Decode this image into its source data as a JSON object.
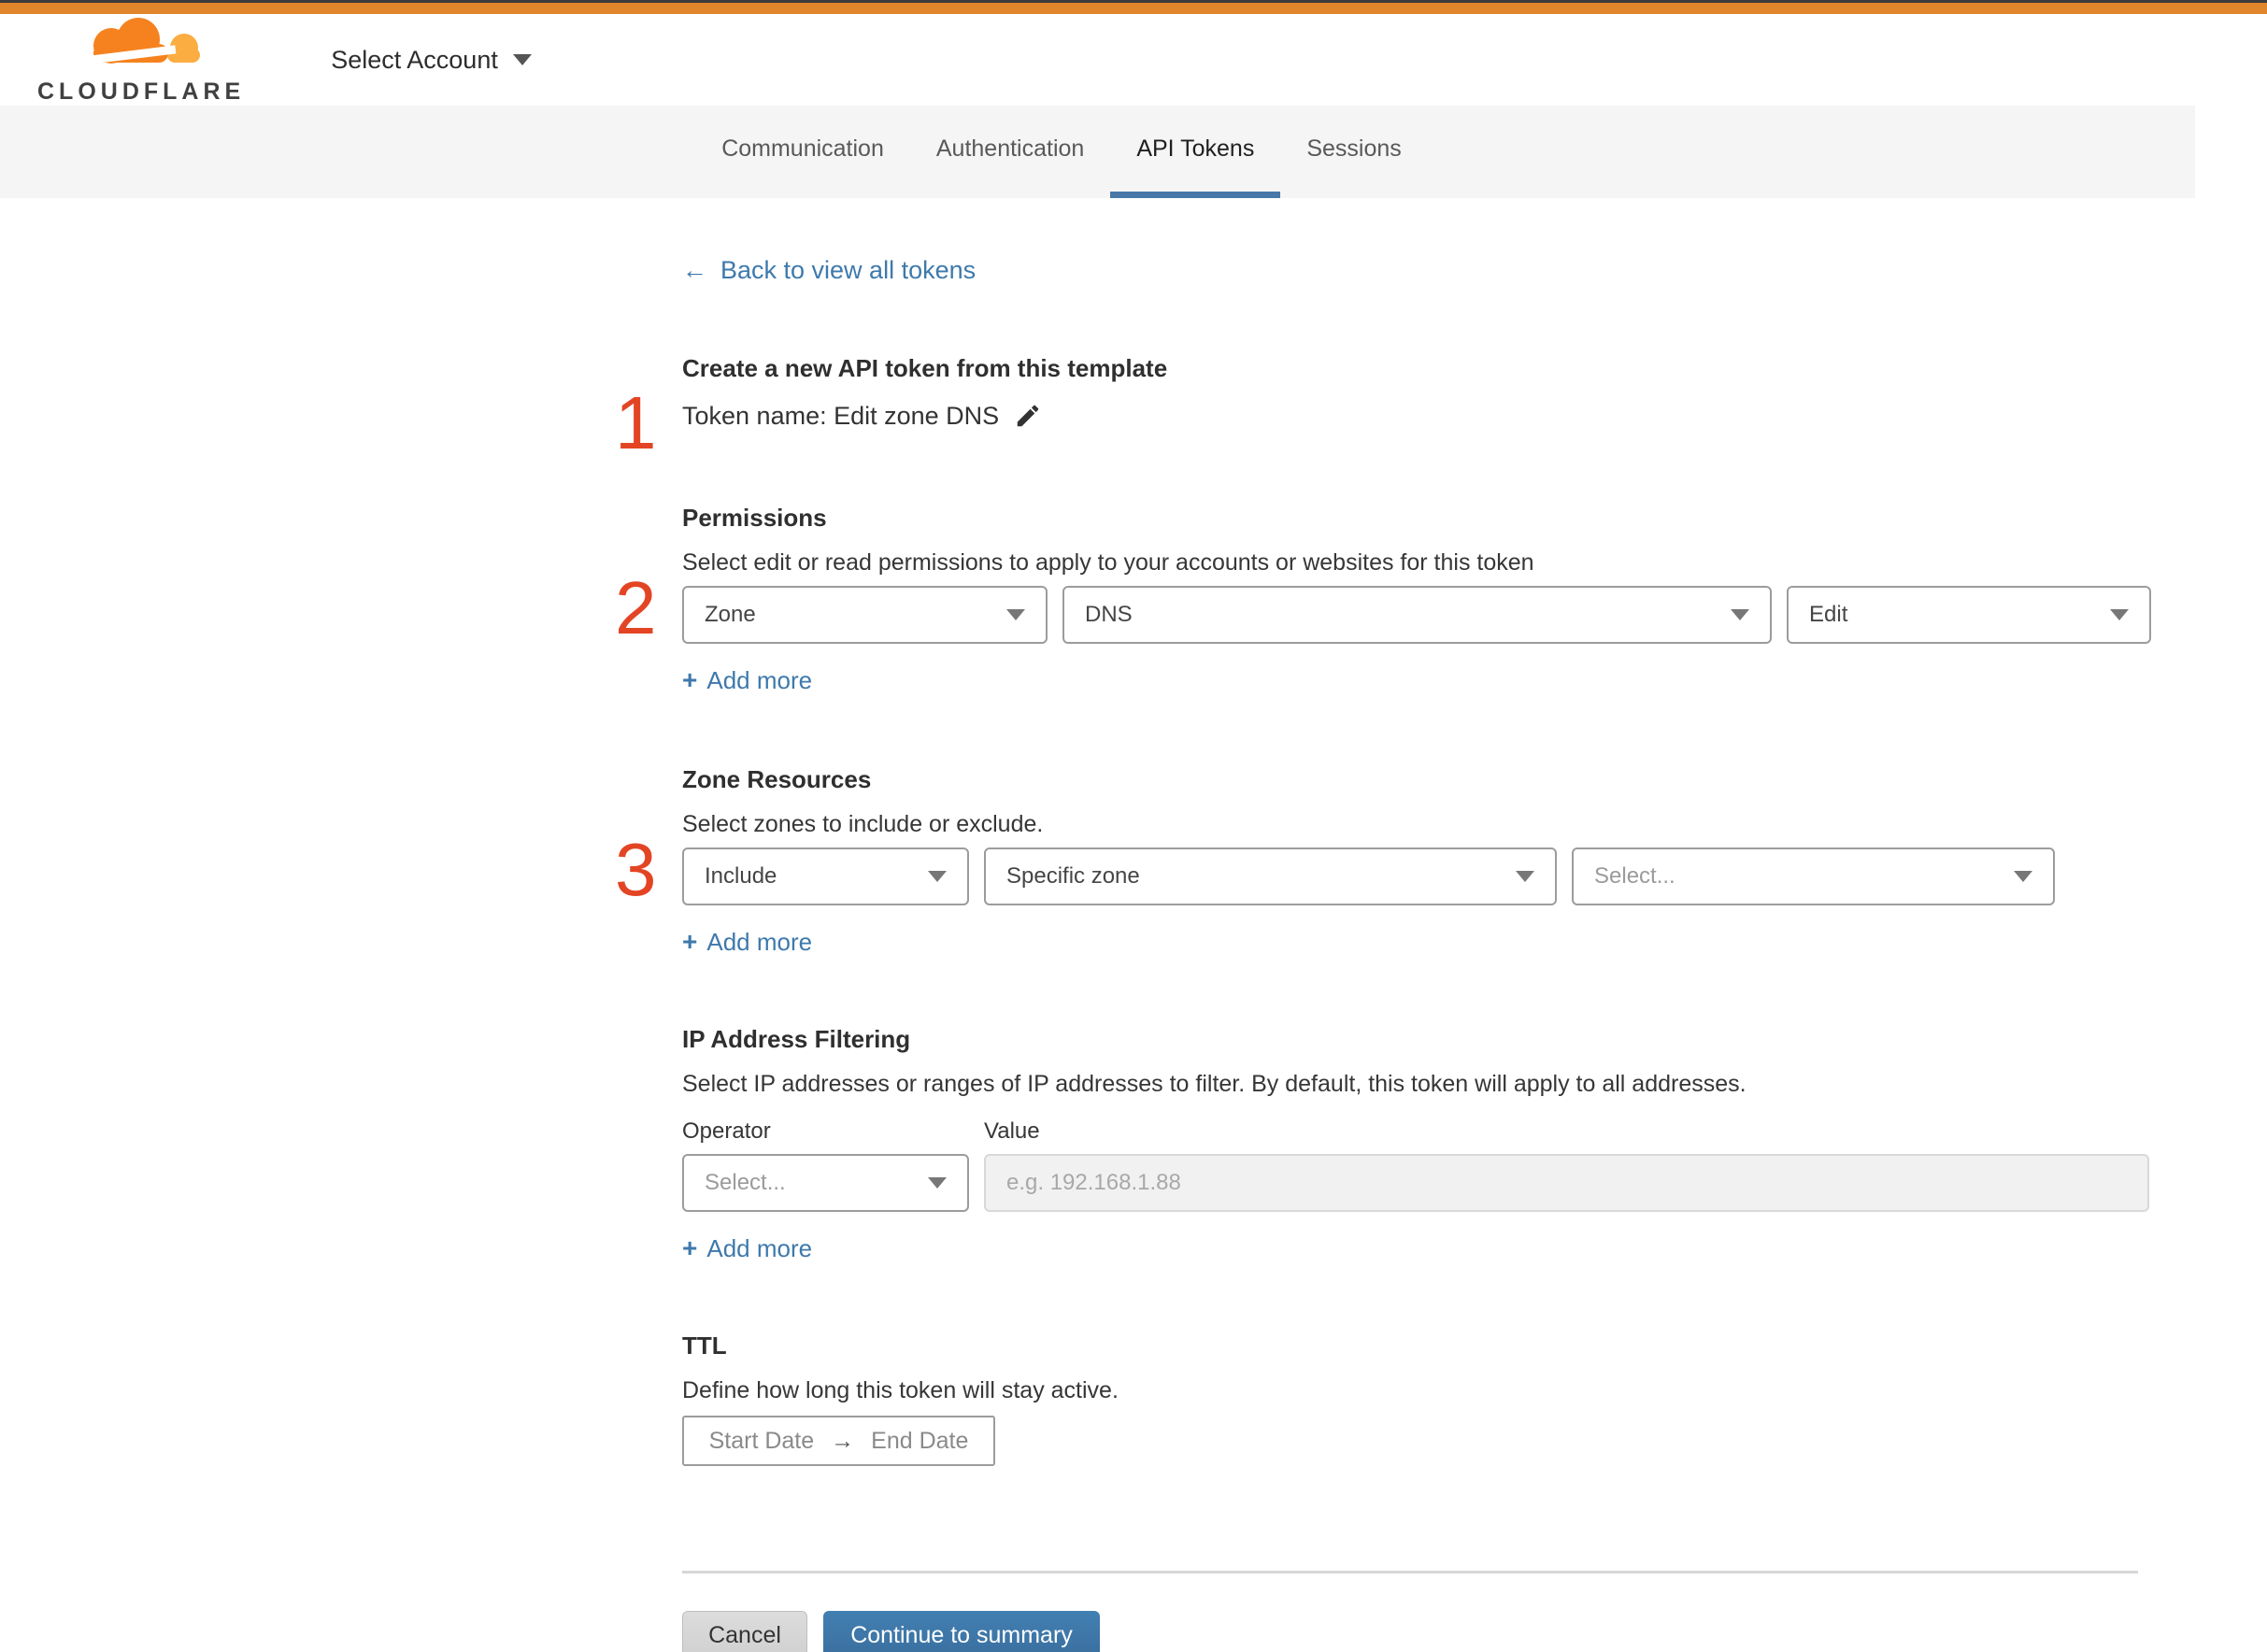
{
  "colors": {
    "top_bar_orange": "#e0862b",
    "brand_orange": "#f6821f",
    "brand_orange_light": "#fbad41",
    "link_blue": "#3e79ac",
    "tab_underline_blue": "#4778a8",
    "step_number_red": "#e34524",
    "primary_button_blue": "#3e74a5"
  },
  "header": {
    "logo_text": "CLOUDFLARE",
    "account_selector_label": "Select Account"
  },
  "tabs": {
    "active": "API Tokens",
    "items": [
      {
        "label": "Communication"
      },
      {
        "label": "Authentication"
      },
      {
        "label": "API Tokens"
      },
      {
        "label": "Sessions"
      }
    ]
  },
  "back_link": {
    "icon": "←",
    "label": "Back to view all tokens"
  },
  "icons": {
    "plus": "+",
    "back_arrow": "←",
    "range_arrow": "→",
    "pencil": "edit-pencil",
    "caret": "dropdown-caret"
  },
  "token_form": {
    "step1": {
      "number": "1",
      "heading": "Create a new API token from this template",
      "token_name": "Token name: Edit zone DNS"
    },
    "permissions": {
      "number": "2",
      "heading": "Permissions",
      "description": "Select edit or read permissions to apply to your accounts or websites for this token",
      "scope_value": "Zone",
      "resource_value": "DNS",
      "access_value": "Edit",
      "add_more_label": "Add more"
    },
    "zone_resources": {
      "number": "3",
      "heading": "Zone Resources",
      "description": "Select zones to include or exclude.",
      "operator_value": "Include",
      "type_value": "Specific zone",
      "zone_placeholder": "Select...",
      "add_more_label": "Add more"
    },
    "ip_filtering": {
      "heading": "IP Address Filtering",
      "description": "Select IP addresses or ranges of IP addresses to filter. By default, this token will apply to all addresses.",
      "operator_label": "Operator",
      "value_label": "Value",
      "operator_placeholder": "Select...",
      "value_placeholder": "e.g. 192.168.1.88",
      "add_more_label": "Add more"
    },
    "ttl": {
      "heading": "TTL",
      "description": "Define how long this token will stay active.",
      "start_label": "Start Date",
      "range_arrow": "→",
      "end_label": "End Date"
    }
  },
  "footer": {
    "cancel_label": "Cancel",
    "continue_label": "Continue to summary"
  }
}
